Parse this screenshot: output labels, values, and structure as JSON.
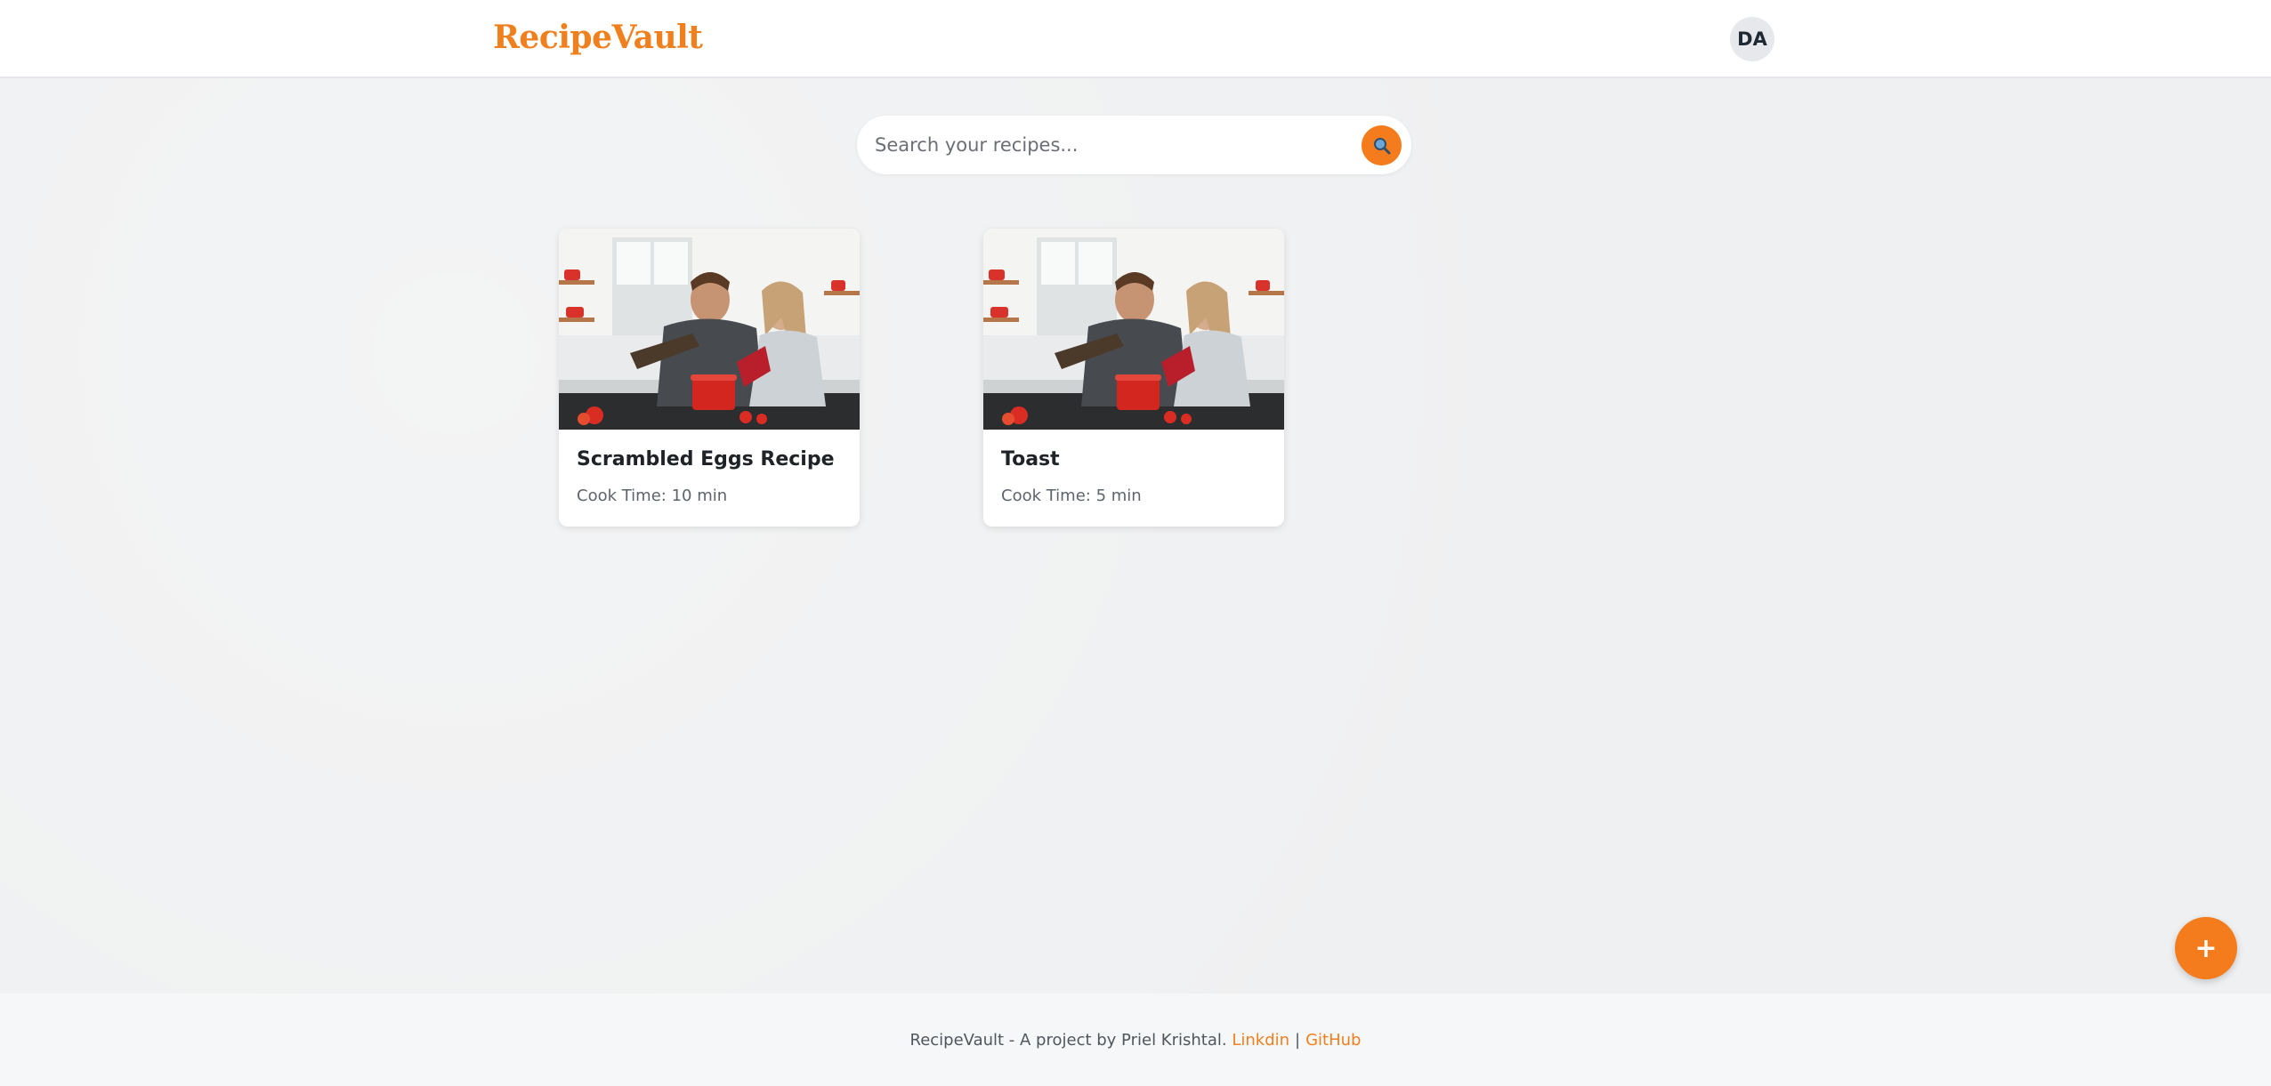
{
  "header": {
    "logo": "RecipeVault",
    "avatar_initials": "DA"
  },
  "search": {
    "placeholder": "Search your recipes...",
    "icon": "search-icon"
  },
  "recipes": [
    {
      "title": "Scrambled Eggs Recipe",
      "cook_time": "Cook Time: 10 min",
      "image": "kitchen-couple-cooking-photo"
    },
    {
      "title": "Toast",
      "cook_time": "Cook Time: 5 min",
      "image": "kitchen-couple-cooking-photo"
    }
  ],
  "fab": {
    "label": "+",
    "icon": "plus-icon"
  },
  "footer": {
    "text": "RecipeVault - A project by Priel Krishtal.",
    "link_linkedin": "Linkdin",
    "separator": "|",
    "link_github": "GitHub"
  },
  "colors": {
    "accent": "#f47c1c",
    "logo": "#f07f1e",
    "background": "#eff0f1",
    "card": "#ffffff"
  }
}
